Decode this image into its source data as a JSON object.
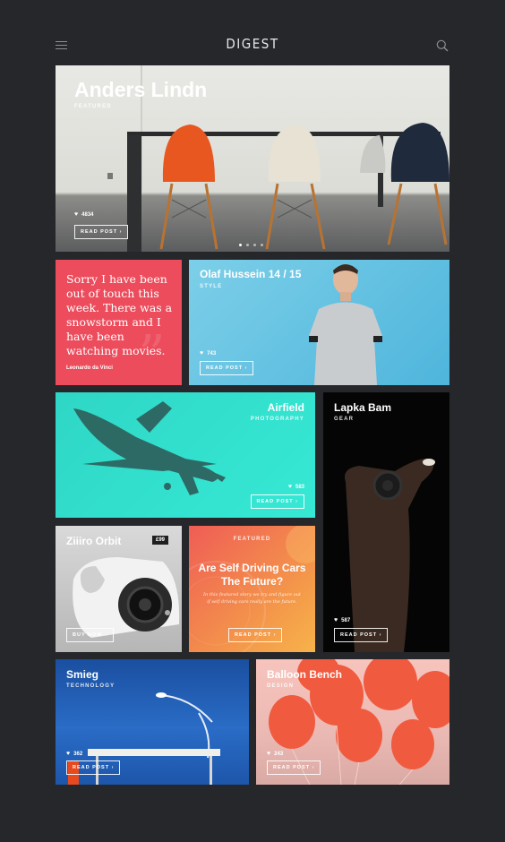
{
  "header": {
    "brand": "DIGEST",
    "menu_icon": "hamburger-icon",
    "search_icon": "search-icon"
  },
  "hero": {
    "title": "Anders Lindn",
    "tag": "FEATURED",
    "likes": "4834",
    "button": "READ POST  ›",
    "slides": 4,
    "active_slide": 1
  },
  "quote": {
    "text": "Sorry I have been out of touch this week. There was a snowstorm and I have been watching movies.",
    "author": "Leonardo da Vinci",
    "mark": "”"
  },
  "olaf": {
    "title": "Olaf Hussein 14 / 15",
    "tag": "STYLE",
    "likes": "743",
    "button": "READ POST  ›"
  },
  "airfield": {
    "title": "Airfield",
    "tag": "PHOTOGRAPHY",
    "likes": "583",
    "button": "READ POST  ›"
  },
  "lapka": {
    "title": "Lapka Bam",
    "tag": "GEAR",
    "likes": "587",
    "button": "READ POST  ›"
  },
  "ziiro": {
    "title": "Ziiiro Orbit",
    "price": "£99",
    "button": "BUY NOW  ›"
  },
  "selfdrive": {
    "tag": "FEATURED",
    "title": "Are Self Driving Cars The Future?",
    "desc": "In this featured story we try and figure out if self driving cars really are the future.",
    "button": "READ POST  ›"
  },
  "smieg": {
    "title": "Smieg",
    "tag": "TECHNOLOGY",
    "likes": "362",
    "button": "READ POST  ›"
  },
  "balloon": {
    "title": "Balloon Bench",
    "tag": "DESIGN",
    "likes": "243",
    "button": "READ POST  ›"
  },
  "colors": {
    "background": "#25272b",
    "coral": "#ec4c5c",
    "sky": "#5bbfe0",
    "turquoise": "#33e0cf",
    "orange": "#f49a4a",
    "blue": "#1f5fb6",
    "pink": "#f0bdb6"
  }
}
